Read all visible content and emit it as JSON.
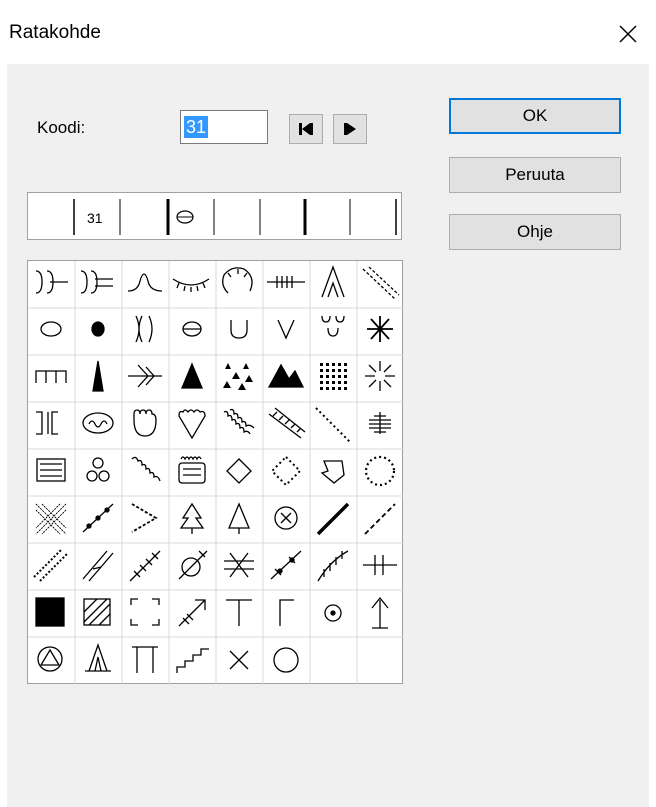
{
  "window": {
    "title": "Ratakohde"
  },
  "form": {
    "code_label": "Koodi:",
    "code_value": "31"
  },
  "preview": {
    "code": "31"
  },
  "buttons": {
    "ok": "OK",
    "cancel": "Peruuta",
    "help": "Ohje"
  },
  "icons": {
    "close": "close-icon",
    "first": "skip-to-first-icon",
    "next": "play-next-icon"
  },
  "symbols": [
    "double-curve-left",
    "double-curve-right",
    "arch-curve",
    "eyelash-curve",
    "semicircle-ticks",
    "hatched-line",
    "tall-arch",
    "double-diagonal",
    "ellipse",
    "dot",
    "double-bracket",
    "ellipse-line",
    "u-shape",
    "v-shape",
    "double-u",
    "asterisk",
    "comb",
    "thin-triangle",
    "branch",
    "triangle",
    "scattered-triangles",
    "double-triangle",
    "dot-grid",
    "radiating-star",
    "bracket-pair",
    "oval-loop",
    "multi-lobe",
    "heart-lobes",
    "wavy-diagonal",
    "hatched-diagonal",
    "dotted-diagonal",
    "striped-line",
    "lines-box",
    "stacked-circles",
    "coil-diagonal",
    "rounded-box",
    "diamond",
    "dotted-diamond",
    "arrow-pentagon",
    "dotted-circle",
    "crosshatch",
    "beaded-diagonal",
    "chevron-dots",
    "tree-small",
    "tree-outline",
    "circle-x",
    "solid-diagonal",
    "dashed-diagonal",
    "dotted-double-diagonal",
    "double-slash",
    "cross-ticks",
    "slashed-circle",
    "double-cross",
    "beaded-slash",
    "fence-diagonal",
    "vertical-bars",
    "black-square",
    "hatched-square",
    "bracket-square",
    "arrow-tail",
    "t-shape",
    "l-shape",
    "circle-dot",
    "up-arrow",
    "circle-triangle",
    "tent",
    "pi-shape",
    "stairs",
    "cross",
    "circle"
  ]
}
